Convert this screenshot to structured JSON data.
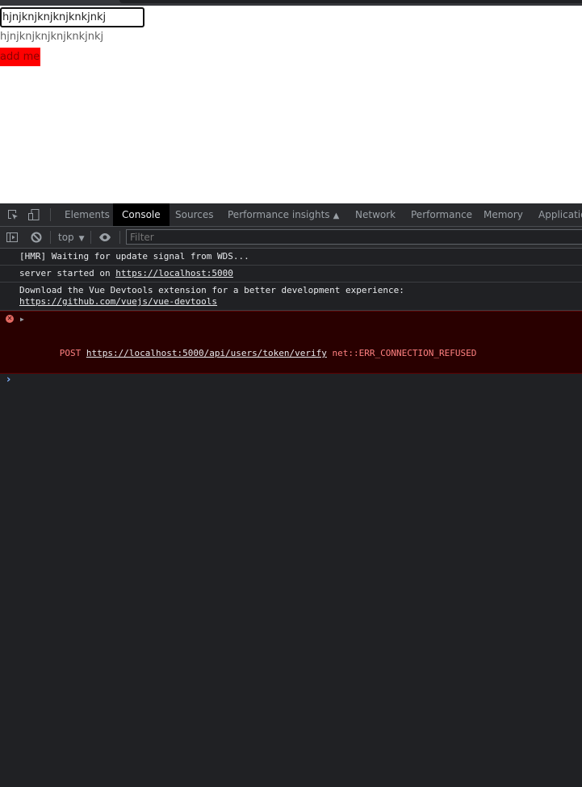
{
  "page": {
    "input_value": "hjnjknjknjknjknkjnkj",
    "mirror_text": "hjnjknjknjknjknkjnkj",
    "add_button_label": "add me",
    "add_button_color": "#ff0000"
  },
  "devtools": {
    "tabs": [
      {
        "label": "Elements",
        "active": false
      },
      {
        "label": "Console",
        "active": true
      },
      {
        "label": "Sources",
        "active": false
      },
      {
        "label": "Performance insights",
        "active": false
      },
      {
        "label": "Network",
        "active": false
      },
      {
        "label": "Performance",
        "active": false
      },
      {
        "label": "Memory",
        "active": false
      },
      {
        "label": "Application",
        "active": false
      }
    ],
    "icons": {
      "inspect": "inspect-element-icon",
      "device": "device-toolbar-icon",
      "sidebar": "show-sidebar-icon",
      "clear": "clear-console-icon",
      "eye": "live-expression-icon",
      "flask": "experimental-flask-icon"
    },
    "toolbar": {
      "context": "top",
      "filter_placeholder": "Filter"
    },
    "console": {
      "messages": [
        {
          "text": "[HMR] Waiting for update signal from WDS..."
        },
        {
          "prefix": "server started on ",
          "link": "https://localhost:5000"
        },
        {
          "text": "Download the Vue Devtools extension for a better development experience:",
          "link": "https://github.com/vuejs/vue-devtools"
        }
      ],
      "error": {
        "method": "POST",
        "url": "https://localhost:5000/api/users/token/verify",
        "detail": "net::ERR_CONNECTION_REFUSED",
        "color": "#ff8080"
      }
    }
  }
}
